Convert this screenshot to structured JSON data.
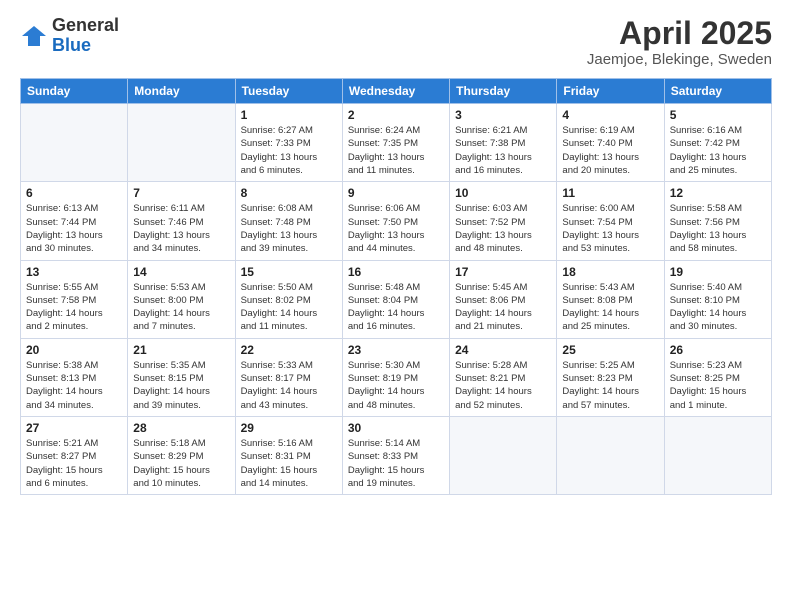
{
  "logo": {
    "general": "General",
    "blue": "Blue"
  },
  "title": "April 2025",
  "location": "Jaemjoe, Blekinge, Sweden",
  "weekdays": [
    "Sunday",
    "Monday",
    "Tuesday",
    "Wednesday",
    "Thursday",
    "Friday",
    "Saturday"
  ],
  "weeks": [
    [
      {
        "day": "",
        "info": ""
      },
      {
        "day": "",
        "info": ""
      },
      {
        "day": "1",
        "info": "Sunrise: 6:27 AM\nSunset: 7:33 PM\nDaylight: 13 hours\nand 6 minutes."
      },
      {
        "day": "2",
        "info": "Sunrise: 6:24 AM\nSunset: 7:35 PM\nDaylight: 13 hours\nand 11 minutes."
      },
      {
        "day": "3",
        "info": "Sunrise: 6:21 AM\nSunset: 7:38 PM\nDaylight: 13 hours\nand 16 minutes."
      },
      {
        "day": "4",
        "info": "Sunrise: 6:19 AM\nSunset: 7:40 PM\nDaylight: 13 hours\nand 20 minutes."
      },
      {
        "day": "5",
        "info": "Sunrise: 6:16 AM\nSunset: 7:42 PM\nDaylight: 13 hours\nand 25 minutes."
      }
    ],
    [
      {
        "day": "6",
        "info": "Sunrise: 6:13 AM\nSunset: 7:44 PM\nDaylight: 13 hours\nand 30 minutes."
      },
      {
        "day": "7",
        "info": "Sunrise: 6:11 AM\nSunset: 7:46 PM\nDaylight: 13 hours\nand 34 minutes."
      },
      {
        "day": "8",
        "info": "Sunrise: 6:08 AM\nSunset: 7:48 PM\nDaylight: 13 hours\nand 39 minutes."
      },
      {
        "day": "9",
        "info": "Sunrise: 6:06 AM\nSunset: 7:50 PM\nDaylight: 13 hours\nand 44 minutes."
      },
      {
        "day": "10",
        "info": "Sunrise: 6:03 AM\nSunset: 7:52 PM\nDaylight: 13 hours\nand 48 minutes."
      },
      {
        "day": "11",
        "info": "Sunrise: 6:00 AM\nSunset: 7:54 PM\nDaylight: 13 hours\nand 53 minutes."
      },
      {
        "day": "12",
        "info": "Sunrise: 5:58 AM\nSunset: 7:56 PM\nDaylight: 13 hours\nand 58 minutes."
      }
    ],
    [
      {
        "day": "13",
        "info": "Sunrise: 5:55 AM\nSunset: 7:58 PM\nDaylight: 14 hours\nand 2 minutes."
      },
      {
        "day": "14",
        "info": "Sunrise: 5:53 AM\nSunset: 8:00 PM\nDaylight: 14 hours\nand 7 minutes."
      },
      {
        "day": "15",
        "info": "Sunrise: 5:50 AM\nSunset: 8:02 PM\nDaylight: 14 hours\nand 11 minutes."
      },
      {
        "day": "16",
        "info": "Sunrise: 5:48 AM\nSunset: 8:04 PM\nDaylight: 14 hours\nand 16 minutes."
      },
      {
        "day": "17",
        "info": "Sunrise: 5:45 AM\nSunset: 8:06 PM\nDaylight: 14 hours\nand 21 minutes."
      },
      {
        "day": "18",
        "info": "Sunrise: 5:43 AM\nSunset: 8:08 PM\nDaylight: 14 hours\nand 25 minutes."
      },
      {
        "day": "19",
        "info": "Sunrise: 5:40 AM\nSunset: 8:10 PM\nDaylight: 14 hours\nand 30 minutes."
      }
    ],
    [
      {
        "day": "20",
        "info": "Sunrise: 5:38 AM\nSunset: 8:13 PM\nDaylight: 14 hours\nand 34 minutes."
      },
      {
        "day": "21",
        "info": "Sunrise: 5:35 AM\nSunset: 8:15 PM\nDaylight: 14 hours\nand 39 minutes."
      },
      {
        "day": "22",
        "info": "Sunrise: 5:33 AM\nSunset: 8:17 PM\nDaylight: 14 hours\nand 43 minutes."
      },
      {
        "day": "23",
        "info": "Sunrise: 5:30 AM\nSunset: 8:19 PM\nDaylight: 14 hours\nand 48 minutes."
      },
      {
        "day": "24",
        "info": "Sunrise: 5:28 AM\nSunset: 8:21 PM\nDaylight: 14 hours\nand 52 minutes."
      },
      {
        "day": "25",
        "info": "Sunrise: 5:25 AM\nSunset: 8:23 PM\nDaylight: 14 hours\nand 57 minutes."
      },
      {
        "day": "26",
        "info": "Sunrise: 5:23 AM\nSunset: 8:25 PM\nDaylight: 15 hours\nand 1 minute."
      }
    ],
    [
      {
        "day": "27",
        "info": "Sunrise: 5:21 AM\nSunset: 8:27 PM\nDaylight: 15 hours\nand 6 minutes."
      },
      {
        "day": "28",
        "info": "Sunrise: 5:18 AM\nSunset: 8:29 PM\nDaylight: 15 hours\nand 10 minutes."
      },
      {
        "day": "29",
        "info": "Sunrise: 5:16 AM\nSunset: 8:31 PM\nDaylight: 15 hours\nand 14 minutes."
      },
      {
        "day": "30",
        "info": "Sunrise: 5:14 AM\nSunset: 8:33 PM\nDaylight: 15 hours\nand 19 minutes."
      },
      {
        "day": "",
        "info": ""
      },
      {
        "day": "",
        "info": ""
      },
      {
        "day": "",
        "info": ""
      }
    ]
  ]
}
